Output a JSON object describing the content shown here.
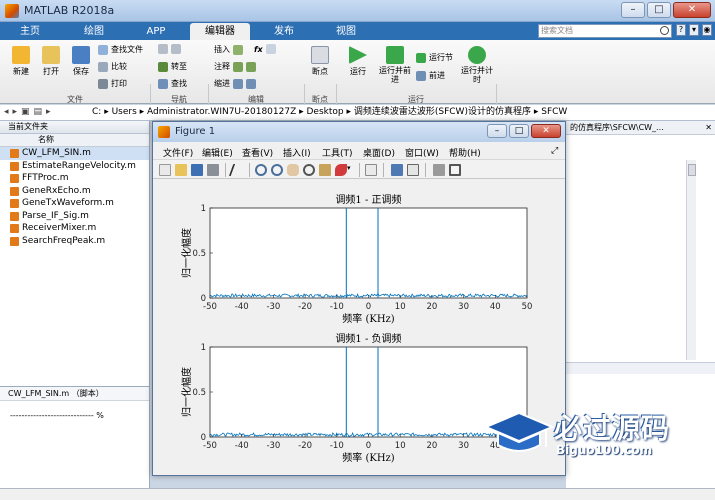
{
  "window": {
    "title": "MATLAB R2018a"
  },
  "tabs": [
    {
      "label": "主页",
      "active": false
    },
    {
      "label": "绘图",
      "active": false
    },
    {
      "label": "APP",
      "active": false
    },
    {
      "label": "编辑器",
      "active": true
    },
    {
      "label": "发布",
      "active": false
    },
    {
      "label": "视图",
      "active": false
    }
  ],
  "search": {
    "placeholder": "搜索文档"
  },
  "ribbon": {
    "file": {
      "new": "新建",
      "open": "打开",
      "save": "保存",
      "find_file": "查找文件",
      "compare": "比较",
      "print": "打印",
      "group": "文件"
    },
    "navigate": {
      "goto": "转至",
      "find": "查找",
      "group": "导航"
    },
    "edit": {
      "insert": "插入",
      "comment": "注释",
      "indent": "缩进",
      "fx": "fx",
      "group": "编辑"
    },
    "breakpoints": {
      "breakpoint": "断点",
      "group": "断点"
    },
    "run": {
      "run": "运行",
      "run_advance": "运行并前进",
      "run_section": "运行节",
      "advance": "前进",
      "run_time": "运行并计时",
      "group": "运行"
    }
  },
  "address": {
    "path": [
      "C:",
      "Users",
      "Administrator.WIN7U-20180127Z",
      "Desktop",
      "调频连续波雷达波形(SFCW)设计的仿真程序",
      "SFCW"
    ]
  },
  "current_folder": {
    "title": "当前文件夹",
    "column": "名称",
    "files": [
      {
        "name": "CW_LFM_SIN.m",
        "selected": true
      },
      {
        "name": "EstimateRangeVelocity.m",
        "selected": false
      },
      {
        "name": "FFTProc.m",
        "selected": false
      },
      {
        "name": "GeneRxEcho.m",
        "selected": false
      },
      {
        "name": "GeneTxWaveform.m",
        "selected": false
      },
      {
        "name": "Parse_IF_Sig.m",
        "selected": false
      },
      {
        "name": "ReceiverMixer.m",
        "selected": false
      },
      {
        "name": "SearchFreqPeak.m",
        "selected": false
      }
    ]
  },
  "details": {
    "title": "CW_LFM_SIN.m （脚本）",
    "text": "----------------------------- %"
  },
  "editor": {
    "path_fragment": "的仿真程序\\SFCW\\CW_..."
  },
  "figure": {
    "title": "Figure 1",
    "menu": [
      "文件(F)",
      "编辑(E)",
      "查看(V)",
      "插入(I)",
      "工具(T)",
      "桌面(D)",
      "窗口(W)",
      "帮助(H)"
    ]
  },
  "chart_data": [
    {
      "type": "line",
      "title": "调频1 - 正调频",
      "xlabel": "频率 (KHz)",
      "ylabel": "归一化幅度",
      "xlim": [
        -50,
        50
      ],
      "ylim": [
        0,
        1
      ],
      "xticks": [
        -50,
        -40,
        -30,
        -20,
        -10,
        0,
        10,
        20,
        30,
        40,
        50
      ],
      "yticks": [
        0,
        0.5,
        1
      ],
      "peaks": [
        {
          "x": -7,
          "y": 1
        },
        {
          "x": 3,
          "y": 1
        }
      ],
      "noise_floor": 0.03,
      "color": "#0072bd"
    },
    {
      "type": "line",
      "title": "调频1 - 负调频",
      "xlabel": "频率 (KHz)",
      "ylabel": "归一化幅度",
      "xlim": [
        -50,
        50
      ],
      "ylim": [
        0,
        1
      ],
      "xticks": [
        -50,
        -40,
        -30,
        -20,
        -10,
        0,
        10,
        20,
        30,
        40,
        50
      ],
      "yticks": [
        0,
        0.5,
        1
      ],
      "peaks": [
        {
          "x": -7,
          "y": 1
        },
        {
          "x": 3,
          "y": 1
        }
      ],
      "noise_floor": 0.03,
      "color": "#0072bd"
    }
  ],
  "watermark": {
    "main": "必过源码",
    "sub": "Biguo100.com"
  }
}
